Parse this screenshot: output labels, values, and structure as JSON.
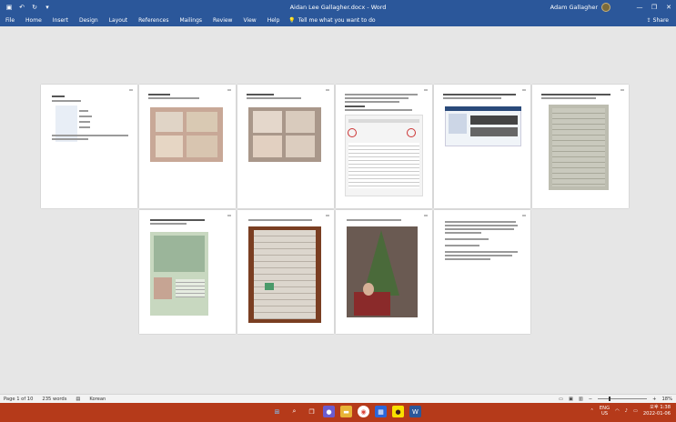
{
  "titlebar": {
    "doc_title": "Aidan Lee Gallagher.docx - Word",
    "user": "Adam Gallagher",
    "min": "—",
    "max": "❐",
    "close": "✕"
  },
  "ribbon": {
    "tabs": [
      "File",
      "Home",
      "Insert",
      "Design",
      "Layout",
      "References",
      "Mailings",
      "Review",
      "View",
      "Help"
    ],
    "tell_me": "Tell me what you want to do",
    "share": "Share"
  },
  "status": {
    "page": "Page 1 of 10",
    "words": "235 words",
    "language": "Korean",
    "zoom": "18%"
  },
  "taskbar": {
    "lang_top": "ENG",
    "lang_bottom": "US",
    "time": "오후 1:38",
    "date": "2022-01-06"
  },
  "colors": {
    "word_blue": "#2b579a",
    "taskbar": "#b53a1a",
    "canvas": "#e6e6e6"
  }
}
